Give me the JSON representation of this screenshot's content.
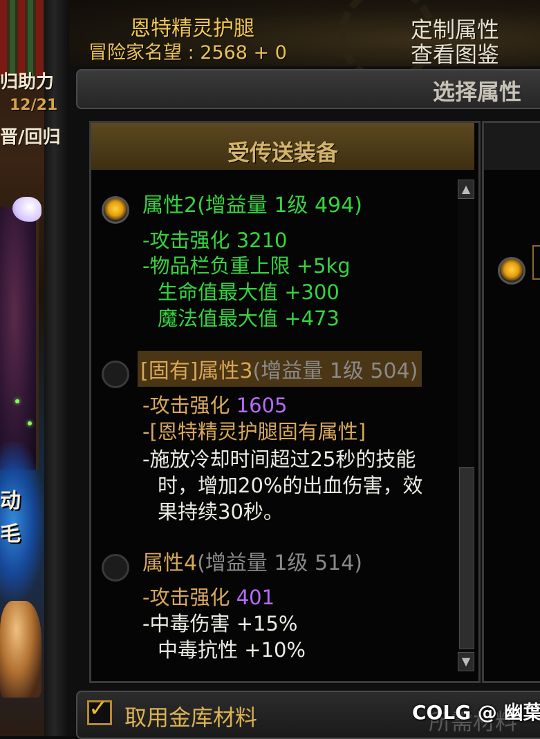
{
  "scene": {
    "line1": "归助力",
    "date": "12/21",
    "line3": "晋/回归",
    "line4": "动",
    "line5": "毛"
  },
  "header": {
    "item_name": "恩特精灵护腿",
    "reputation_label": "冒险家名望",
    "reputation_value": "2568 + 0",
    "custom_attr_button": "定制属性",
    "view_guide_button": "查看图鉴"
  },
  "select_bar": {
    "label": "选择属性"
  },
  "list": {
    "title": "受传送装备",
    "options": [
      {
        "selected": true,
        "prefix": "",
        "name": "属性2",
        "tag": "(增益量 1级 494)",
        "lines": [
          {
            "dash": "-",
            "text": "攻击强化",
            "value": "3210"
          },
          {
            "dash": "-",
            "text": "物品栏负重上限",
            "value": "+5kg"
          },
          {
            "dash": "",
            "text": "生命值最大值",
            "value": "+300"
          },
          {
            "dash": "",
            "text": "魔法值最大值",
            "value": "+473"
          }
        ]
      },
      {
        "selected": false,
        "prefix": "[固有]",
        "name": "属性3",
        "tag": "(增益量 1级 504)",
        "lines": [
          {
            "dash": "-",
            "text": "攻击强化",
            "value": "1605"
          },
          {
            "dash": "-",
            "text": "[恩特精灵护腿固有属性]",
            "value": ""
          },
          {
            "dash": "-",
            "text": "施放冷却时间超过25秒的技能",
            "value": ""
          },
          {
            "dash": "",
            "text": "时，增加20%的出血伤害，效",
            "value": ""
          },
          {
            "dash": "",
            "text": "果持续30秒。",
            "value": ""
          }
        ]
      },
      {
        "selected": false,
        "prefix": "",
        "name": "属性4",
        "tag": "(增益量 1级 514)",
        "lines": [
          {
            "dash": "-",
            "text": "攻击强化",
            "value": "401"
          },
          {
            "dash": "-",
            "text": "中毒伤害",
            "value": "+15%"
          },
          {
            "dash": "",
            "text": "中毒抗性",
            "value": "+10%"
          }
        ]
      }
    ]
  },
  "footer": {
    "checkbox_label": "取用金库材料",
    "checkbox_checked": true,
    "faded_button": "所需材料"
  },
  "watermark": "COLG @ 幽葉",
  "colors": {
    "green": "#35d43f",
    "gold": "#d8a858",
    "purple": "#b86bff",
    "title_gold": "#f3c84f"
  }
}
